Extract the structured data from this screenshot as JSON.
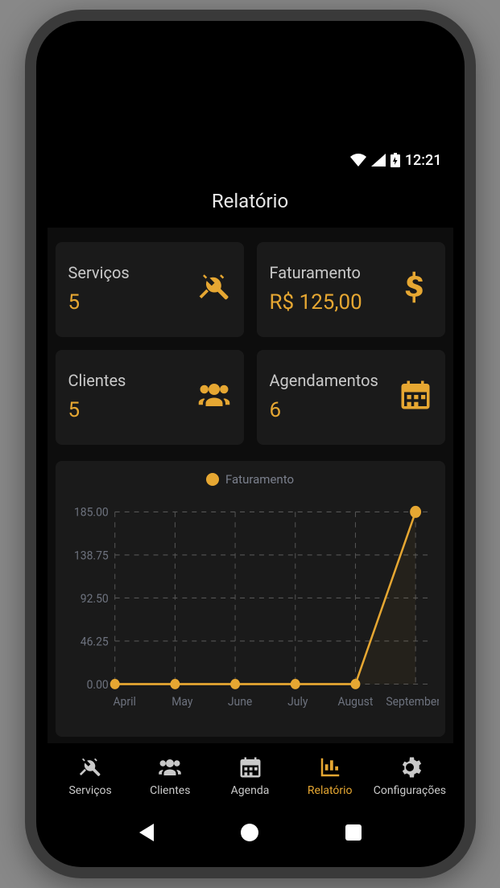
{
  "statusbar": {
    "time": "12:21"
  },
  "header": {
    "title": "Relatório"
  },
  "cards": [
    {
      "label": "Serviços",
      "value": "5",
      "icon": "tools-icon"
    },
    {
      "label": "Faturamento",
      "value": "R$ 125,00",
      "icon": "dollar-icon"
    },
    {
      "label": "Clientes",
      "value": "5",
      "icon": "users-icon"
    },
    {
      "label": "Agendamentos",
      "value": "6",
      "icon": "calendar-icon"
    }
  ],
  "chart_data": {
    "type": "line",
    "legend": "Faturamento",
    "categories": [
      "April",
      "May",
      "June",
      "July",
      "August",
      "September"
    ],
    "values": [
      0,
      0,
      0,
      0,
      0,
      185
    ],
    "y_ticks": [
      "0.00",
      "46.25",
      "92.50",
      "138.75",
      "185.00"
    ],
    "ylim": [
      0,
      185
    ]
  },
  "tabs": [
    {
      "label": "Serviços",
      "icon": "tools-icon",
      "active": false
    },
    {
      "label": "Clientes",
      "icon": "users-icon",
      "active": false
    },
    {
      "label": "Agenda",
      "icon": "calendar-icon",
      "active": false
    },
    {
      "label": "Relatório",
      "icon": "chart-icon",
      "active": true
    },
    {
      "label": "Configurações",
      "icon": "gear-icon",
      "active": false
    }
  ],
  "colors": {
    "accent": "#e6a732",
    "card_bg": "#1a1a1a",
    "bg": "#0d0d0d"
  }
}
